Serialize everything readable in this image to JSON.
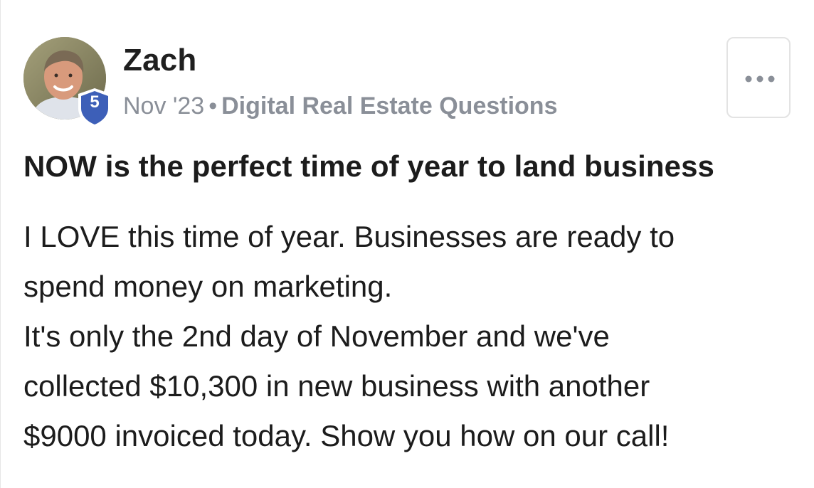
{
  "post": {
    "author_name": "Zach",
    "level": "5",
    "date": "Nov '23",
    "separator": "•",
    "category": "Digital Real Estate Questions",
    "title": "NOW is the perfect time of year to land business",
    "body_lines": [
      "I LOVE this time of year. Businesses are ready to",
      "spend money on marketing.",
      "It's only the 2nd day of November and we've",
      "collected $10,300 in new business with another",
      "$9000 invoiced today. Show you how on our call!"
    ]
  },
  "icons": {
    "more": "more-horizontal-icon",
    "level_badge": "shield-badge-icon"
  },
  "colors": {
    "badge": "#3d5fb8",
    "meta_text": "#8a8f98",
    "text": "#1c1c1c"
  }
}
